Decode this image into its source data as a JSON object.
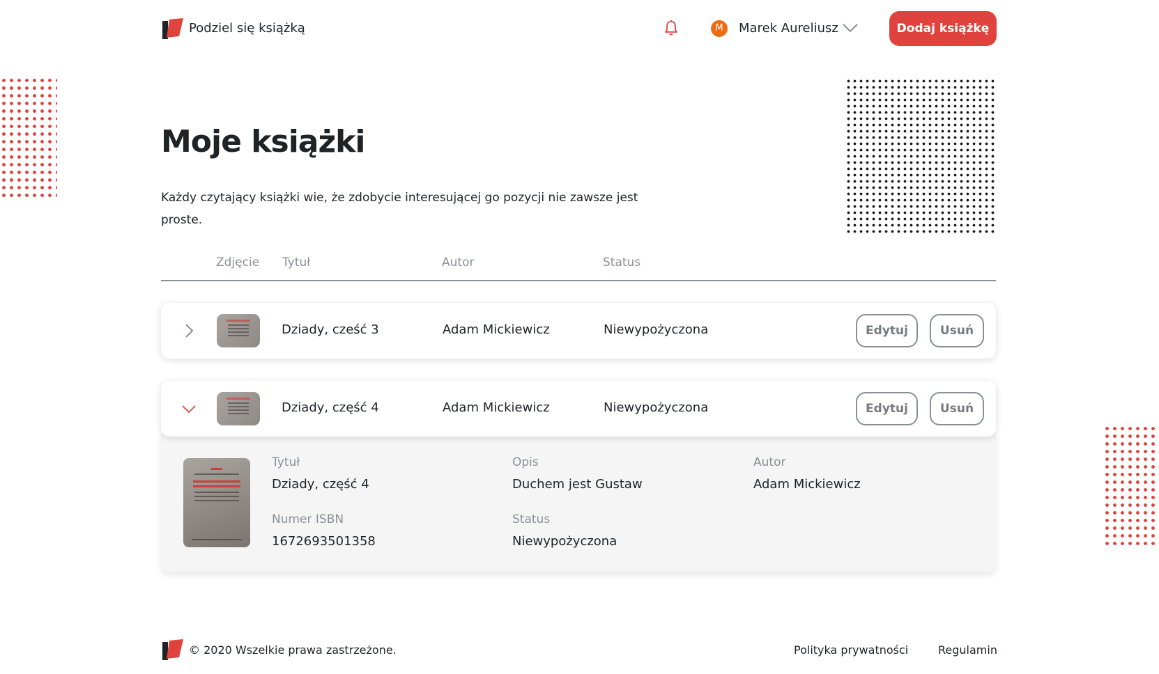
{
  "header": {
    "brand": "Podziel się książką",
    "user_initial": "M",
    "user_name": "Marek Aureliusz",
    "add_button": "Dodaj książkę"
  },
  "page": {
    "title": "Moje książki",
    "description": "Każdy czytający książki wie, że zdobycie interesującej go pozycji nie zawsze jest proste."
  },
  "table": {
    "columns": [
      "Zdjęcie",
      "Tytuł",
      "Autor",
      "Status"
    ],
    "rows": [
      {
        "title": "Dziady, cześć 3",
        "author": "Adam Mickiewicz",
        "status": "Niewypożyczona",
        "edit": "Edytuj",
        "delete": "Usuń",
        "expanded": false
      },
      {
        "title": "Dziady, część 4",
        "author": "Adam Mickiewicz",
        "status": "Niewypożyczona",
        "edit": "Edytuj",
        "delete": "Usuń",
        "expanded": true
      }
    ]
  },
  "details": {
    "title_label": "Tytuł",
    "title_value": "Dziady, część 4",
    "description_label": "Opis",
    "description_value": "Duchem jest Gustaw",
    "author_label": "Autor",
    "author_value": "Adam Mickiewicz",
    "isbn_label": "Numer ISBN",
    "isbn_value": "1672693501358",
    "status_label": "Status",
    "status_value": "Niewypożyczona"
  },
  "footer": {
    "copyright": "© 2020 Wszelkie prawa zastrzeżone.",
    "privacy": "Polityka prywatności",
    "terms": "Regulamin"
  },
  "colors": {
    "accent": "#e0433e",
    "avatar": "#ef6b12",
    "muted": "#8b8f94",
    "text": "#1f2326"
  },
  "icons": {
    "logo": "book-logo-icon",
    "bell": "bell-icon",
    "user_menu": "chevron-down-icon",
    "row_collapsed": "chevron-right-icon",
    "row_expanded": "chevron-down-icon"
  }
}
